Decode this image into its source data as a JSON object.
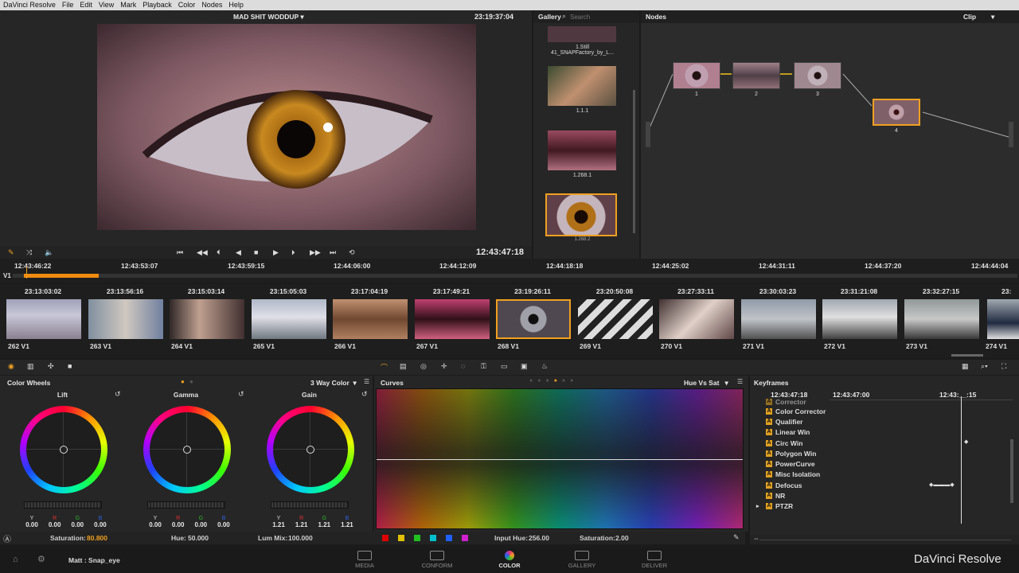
{
  "menubar": {
    "app_name": "DaVinci Resolve",
    "items": [
      "File",
      "Edit",
      "View",
      "Mark",
      "Playback",
      "Color",
      "Nodes",
      "Help"
    ]
  },
  "viewer": {
    "clip_title": "MAD SHIT WODDUP",
    "timecode_top": "23:19:37:04",
    "timecode_bottom": "12:43:47:18"
  },
  "gallery": {
    "title": "Gallery",
    "search_placeholder": "Search",
    "stills": [
      {
        "label": "1.Still\n41_SNAPFactory_by_L..."
      },
      {
        "label": "1.1.1"
      },
      {
        "label": "1.268.1"
      },
      {
        "label": "1.268.2"
      }
    ]
  },
  "nodes": {
    "title": "Nodes",
    "mode": "Clip",
    "labels": [
      "1",
      "2",
      "3",
      "4"
    ]
  },
  "timeline": {
    "track": "V1",
    "ruler": [
      "12:43:46:22",
      "12:43:53:07",
      "12:43:59:15",
      "12:44:06:00",
      "12:44:12:09",
      "12:44:18:18",
      "12:44:25:02",
      "12:44:31:11",
      "12:44:37:20",
      "12:44:44:04"
    ]
  },
  "clips": [
    {
      "tc": "23:13:03:02",
      "label": "262 V1"
    },
    {
      "tc": "23:13:56:16",
      "label": "263 V1"
    },
    {
      "tc": "23:15:03:14",
      "label": "264 V1"
    },
    {
      "tc": "23:15:05:03",
      "label": "265 V1"
    },
    {
      "tc": "23:17:04:19",
      "label": "266 V1"
    },
    {
      "tc": "23:17:49:21",
      "label": "267 V1"
    },
    {
      "tc": "23:19:26:11",
      "label": "268 V1"
    },
    {
      "tc": "23:20:50:08",
      "label": "269 V1"
    },
    {
      "tc": "23:27:33:11",
      "label": "270 V1"
    },
    {
      "tc": "23:30:03:23",
      "label": "271 V1"
    },
    {
      "tc": "23:31:21:08",
      "label": "272 V1"
    },
    {
      "tc": "23:32:27:15",
      "label": "273 V1"
    },
    {
      "tc": "23:",
      "label": "274 V1"
    }
  ],
  "color_wheels": {
    "title": "Color Wheels",
    "mode": "3 Way Color",
    "wheels": [
      {
        "name": "Lift",
        "values": [
          "0.00",
          "0.00",
          "0.00",
          "0.00"
        ]
      },
      {
        "name": "Gamma",
        "values": [
          "0.00",
          "0.00",
          "0.00",
          "0.00"
        ]
      },
      {
        "name": "Gain",
        "values": [
          "1.21",
          "1.21",
          "1.21",
          "1.21"
        ]
      }
    ],
    "channels": [
      "Y",
      "R",
      "G",
      "B"
    ],
    "saturation_label": "Saturation:",
    "saturation": "80.800",
    "hue_label": "Hue:",
    "hue": "50.000",
    "lummix_label": "Lum Mix:",
    "lummix": "100.000"
  },
  "curves": {
    "title": "Curves",
    "mode": "Hue Vs Sat",
    "input_hue_label": "Input Hue:",
    "input_hue": "256.00",
    "saturation_label": "Saturation:",
    "saturation": "2.00",
    "swatches": [
      "#e00000",
      "#e0c000",
      "#20c020",
      "#00c0d0",
      "#2060ff",
      "#d020d0"
    ]
  },
  "keyframes": {
    "title": "Keyframes",
    "tc_current": "12:43:47:18",
    "tc_mid": "12:43:47:00",
    "tc_right": "12:43:__:15",
    "items": [
      "Corrector",
      "Color Corrector",
      "Qualifier",
      "Linear Win",
      "Circ Win",
      "Polygon Win",
      "PowerCurve",
      "Misc Isolation",
      "Defocus",
      "NR",
      "PTZR"
    ]
  },
  "pages": {
    "user": "Matt : Snap_eye",
    "items": [
      "MEDIA",
      "CONFORM",
      "COLOR",
      "GALLERY",
      "DELIVER"
    ],
    "active": "COLOR",
    "brand": "DaVinci Resolve"
  },
  "colors": {
    "accent": "#f0a020",
    "active_page": "#e03080"
  }
}
